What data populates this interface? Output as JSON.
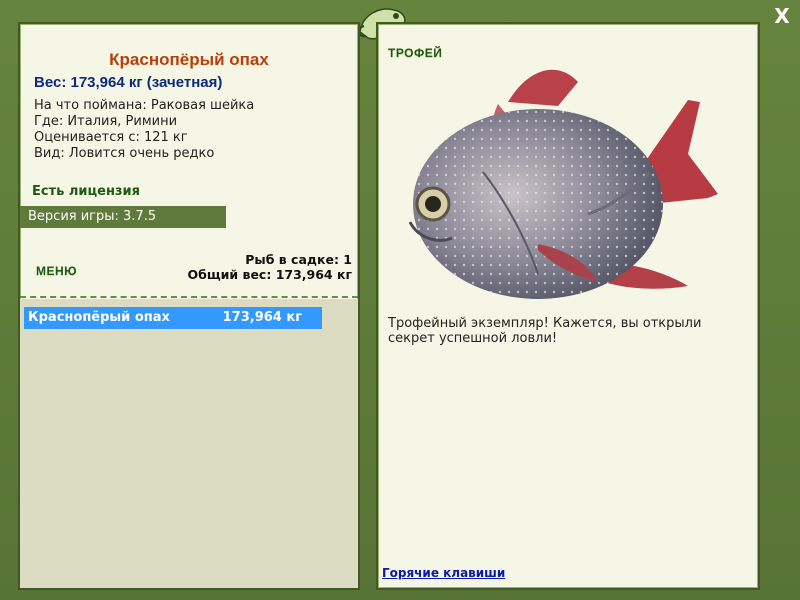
{
  "window": {
    "close_label": "X"
  },
  "fish": {
    "name": "Краснопёрый опах",
    "weight_line": "Вес: 173,964 кг (зачетная)",
    "info": [
      "На что поймана: Раковая шейка",
      "Где: Италия, Римини",
      "Оценивается с: 121 кг",
      "Вид: Ловится очень редко"
    ]
  },
  "license": "Есть лицензия",
  "version": "Версия игры: 3.7.5",
  "menu_label": "МЕНЮ",
  "stats": {
    "count": "Рыб в садке: 1",
    "total": "Общий вес: 173,964 кг"
  },
  "catch_list": [
    {
      "name": "Краснопёрый опах",
      "weight": "173,964 кг"
    }
  ],
  "trophy": {
    "heading": "ТРОФЕЙ",
    "description": "Трофейный экземпляр! Кажется, вы открыли секрет успешной ловли!",
    "hotkeys_link": "Горячие клавиши"
  },
  "colors": {
    "frame": "#5f7a3a",
    "panel": "#f6f6e6",
    "title": "#b6400b",
    "weight": "#0b2a78",
    "selection": "#3399ff"
  }
}
